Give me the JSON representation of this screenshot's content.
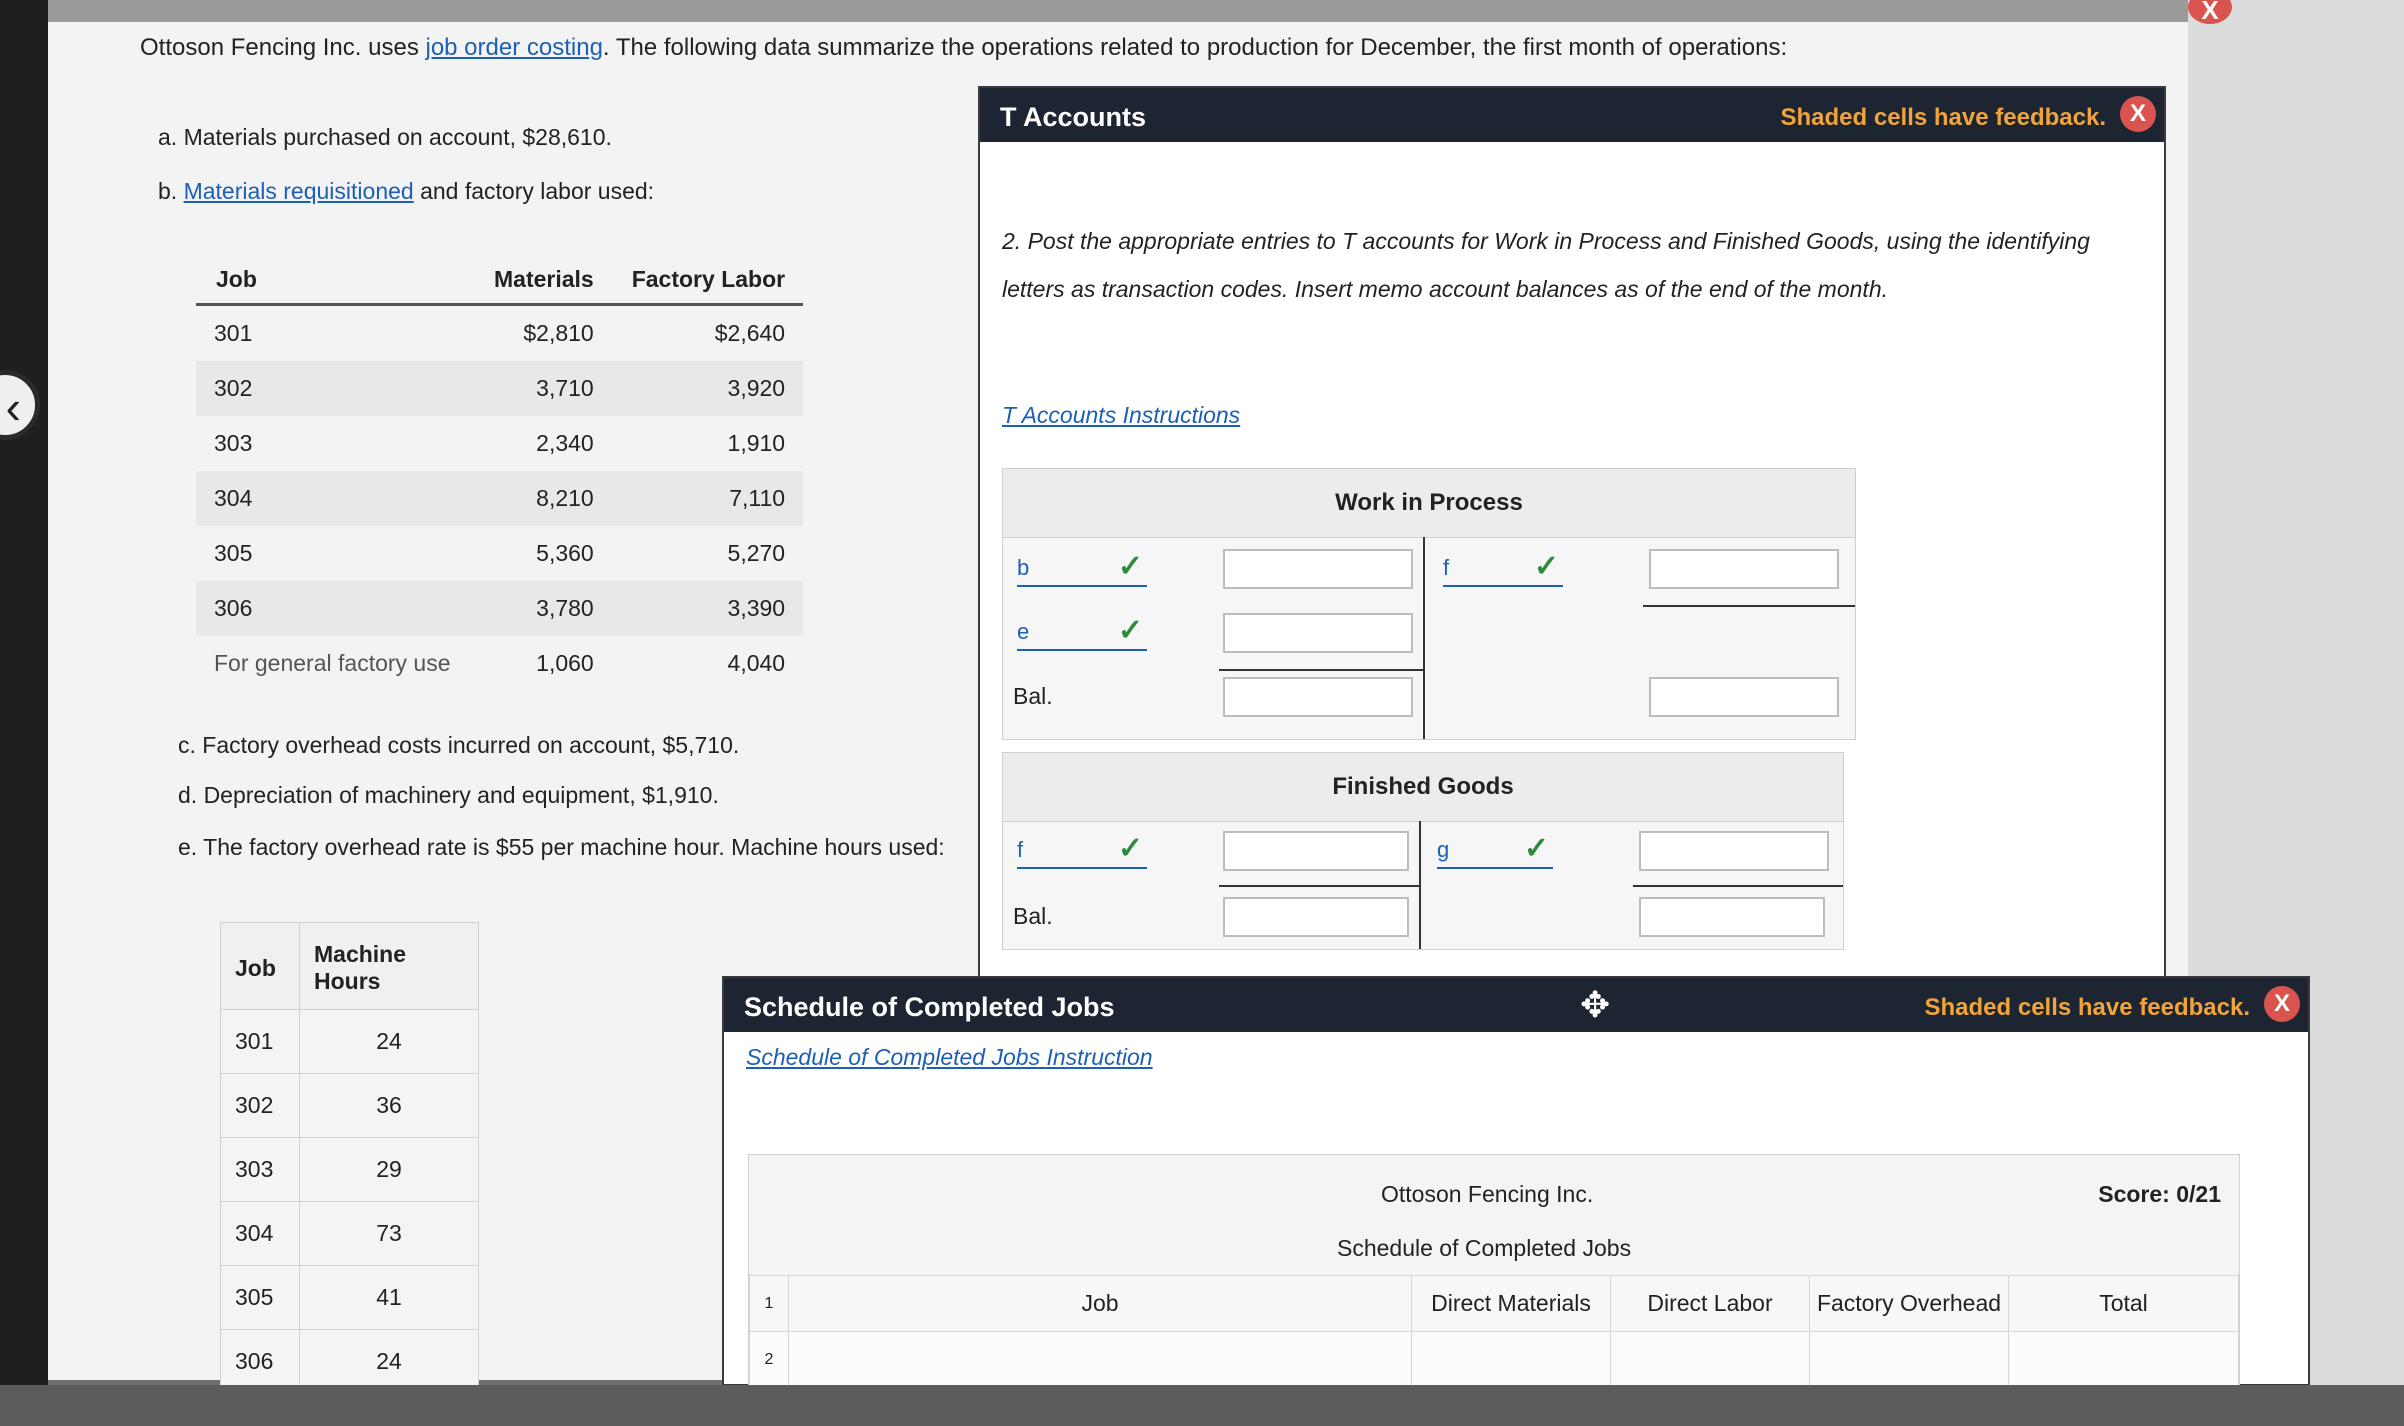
{
  "intro": {
    "prefix": "Ottoson Fencing Inc. uses ",
    "link": "job order costing",
    "suffix": ". The following data summarize the operations related to production for December, the first month of operations:"
  },
  "items": {
    "a": "a. Materials purchased on account, $28,610.",
    "b_prefix": "b. ",
    "b_link": "Materials requisitioned",
    "b_suffix": " and factory labor used:",
    "c": "c. Factory overhead costs incurred on account, $5,710.",
    "d": "d. Depreciation of machinery and equipment, $1,910.",
    "e": "e. The factory overhead rate is $55 per machine hour. Machine hours used:"
  },
  "materials_table": {
    "headers": [
      "Job",
      "Materials",
      "Factory Labor"
    ],
    "rows": [
      [
        "301",
        "$2,810",
        "$2,640"
      ],
      [
        "302",
        "3,710",
        "3,920"
      ],
      [
        "303",
        "2,340",
        "1,910"
      ],
      [
        "304",
        "8,210",
        "7,110"
      ],
      [
        "305",
        "5,360",
        "5,270"
      ],
      [
        "306",
        "3,780",
        "3,390"
      ],
      [
        "For general factory use",
        "1,060",
        "4,040"
      ]
    ]
  },
  "machine_table": {
    "headers": [
      "Job",
      "Machine Hours"
    ],
    "rows": [
      [
        "301",
        "24"
      ],
      [
        "302",
        "36"
      ],
      [
        "303",
        "29"
      ],
      [
        "304",
        "73"
      ],
      [
        "305",
        "41"
      ],
      [
        "306",
        "24"
      ]
    ]
  },
  "t_panel": {
    "title": "T Accounts",
    "feedback": "Shaded cells have feedback.",
    "close": "X",
    "instruction_line1": "2. Post the appropriate entries to T accounts for Work in Process and Finished Goods, using the identifying",
    "instruction_line2": "letters as transaction codes. Insert memo account balances as of the end of the month.",
    "instructions_link": "T Accounts Instructions",
    "wip": {
      "title": "Work in Process",
      "debit_codes": [
        "b",
        "e"
      ],
      "credit_codes": [
        "f"
      ],
      "bal": "Bal."
    },
    "fg": {
      "title": "Finished Goods",
      "debit_codes": [
        "f"
      ],
      "credit_codes": [
        "g"
      ],
      "bal": "Bal."
    },
    "checkmark": "✓"
  },
  "s_panel": {
    "title": "Schedule of Completed Jobs",
    "feedback": "Shaded cells have feedback.",
    "close": "X",
    "move_icon": "✥",
    "instructions_link": "Schedule of Completed Jobs Instruction",
    "company": "Ottoson Fencing Inc.",
    "schedule_title": "Schedule of Completed Jobs",
    "score": "Score: 0/21",
    "columns": [
      "Job",
      "Direct Materials",
      "Direct Labor",
      "Factory Overhead",
      "Total"
    ],
    "row_numbers": [
      "1",
      "2"
    ]
  },
  "corner_close": "X",
  "back_chevron": "‹"
}
